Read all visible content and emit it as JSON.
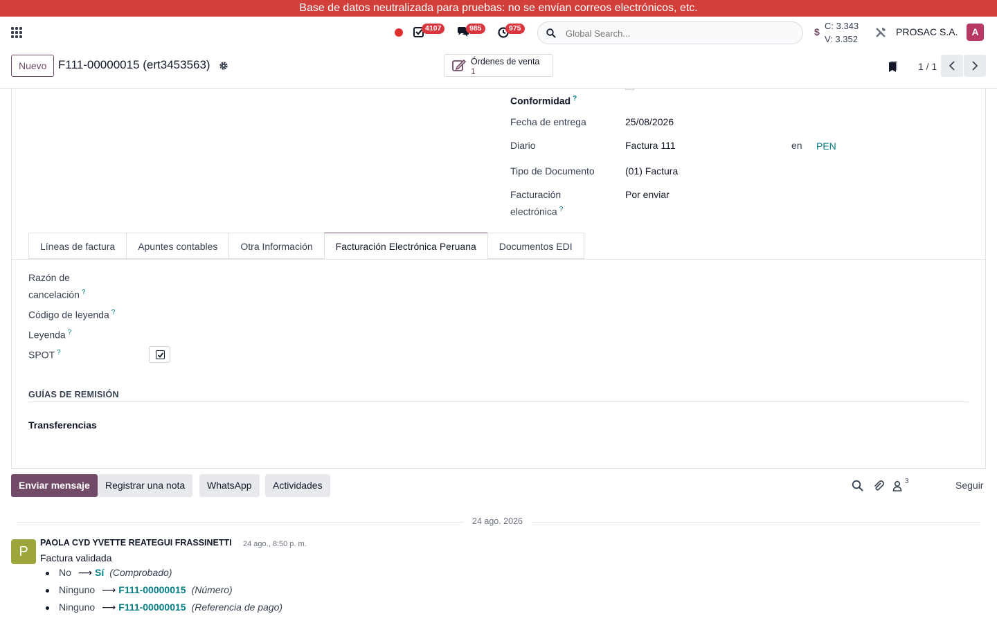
{
  "banner": "Base de datos neutralizada para pruebas: no se envían correos electrónicos, etc.",
  "navbar": {
    "badge_activities": "4107",
    "badge_messages": "985",
    "badge_timers": "975",
    "search_placeholder": "Global Search...",
    "rate_symbol": "$",
    "rate_buy": "C: 3.343",
    "rate_sell": "V: 3.352",
    "company": "PROSAC S.A.",
    "avatar_letter": "A"
  },
  "control": {
    "new_button": "Nuevo",
    "record_title": "F111-00000015 (ert3453563)",
    "smart_button_label": "Órdenes de venta",
    "smart_button_count": "1",
    "pager": "1 / 1"
  },
  "fields": {
    "conformidad_label": "Conformidad",
    "fecha_entrega_label": "Fecha de entrega",
    "fecha_entrega_value": "25/08/2026",
    "diario_label": "Diario",
    "diario_value": "Factura 111",
    "diario_en": "en",
    "diario_currency": "PEN",
    "tipo_doc_label": "Tipo de Documento",
    "tipo_doc_value": "(01) Factura",
    "fe_label_line1": "Facturación",
    "fe_label_line2": "electrónica",
    "fe_value": "Por enviar"
  },
  "tabs": [
    {
      "label": "Líneas de factura"
    },
    {
      "label": "Apuntes contables"
    },
    {
      "label": "Otra Información"
    },
    {
      "label": "Facturación Electrónica Peruana"
    },
    {
      "label": "Documentos EDI"
    }
  ],
  "tab_fields": {
    "razon_line1": "Razón de",
    "razon_line2": "cancelación",
    "codigo_leyenda": "Código de leyenda",
    "leyenda": "Leyenda",
    "spot": "SPOT",
    "spot_checked": true,
    "guias_title": "GUÍAS DE REMISIÓN",
    "transferencias": "Transferencias"
  },
  "help_mark": "?",
  "chatter": {
    "send_message": "Enviar mensaje",
    "log_note": "Registrar una nota",
    "whatsapp": "WhatsApp",
    "activities": "Actividades",
    "followers_count": "3",
    "follow": "Seguir",
    "date": "24 ago. 2026",
    "author_initial": "P",
    "author": "PAOLA CYD YVETTE REATEGUI FRASSINETTI",
    "time": "24 ago., 8:50 p. m.",
    "body": "Factura validada",
    "tracking": [
      {
        "old": "No",
        "new": "Sí",
        "field": "(Comprobado)"
      },
      {
        "old": "Ninguno",
        "new": "F111-00000015",
        "field": "(Número)"
      },
      {
        "old": "Ninguno",
        "new": "F111-00000015",
        "field": "(Referencia de pago)"
      }
    ]
  },
  "colors": {
    "banner": "#d23f3a",
    "brand": "#714b67",
    "link": "#017e84",
    "badge": "#d9363e"
  }
}
